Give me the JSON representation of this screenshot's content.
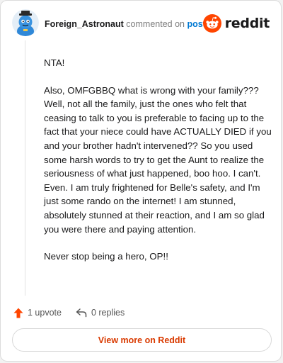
{
  "comment": {
    "author": "Foreign_Astronaut",
    "action_text": " commented on ",
    "target_text": "post",
    "paragraphs": [
      "NTA!",
      "Also, OMFGBBQ what is wrong with your family??? Well, not all the family, just the ones who felt that ceasing to talk to you is preferable to facing up to the fact that your niece could have ACTUALLY DIED if you and your brother hadn't intervened?? So you used some harsh words to try to get the Aunt to realize the seriousness of what just happened, boo hoo. I can't. Even. I am truly frightened for Belle's safety, and I'm just some rando on the internet! I am stunned, absolutely stunned at their reaction, and I am so glad you were there and paying attention.",
      "Never stop being a hero, OP!!"
    ]
  },
  "brand": {
    "wordmark": "reddit",
    "icon": "reddit-logo-icon",
    "color": "#ff4500"
  },
  "actions": {
    "upvote_label": "1 upvote",
    "upvote_icon": "upvote-arrow-icon",
    "reply_label": "0 replies",
    "reply_icon": "reply-arrow-icon"
  },
  "cta": {
    "label": "View more on Reddit"
  }
}
